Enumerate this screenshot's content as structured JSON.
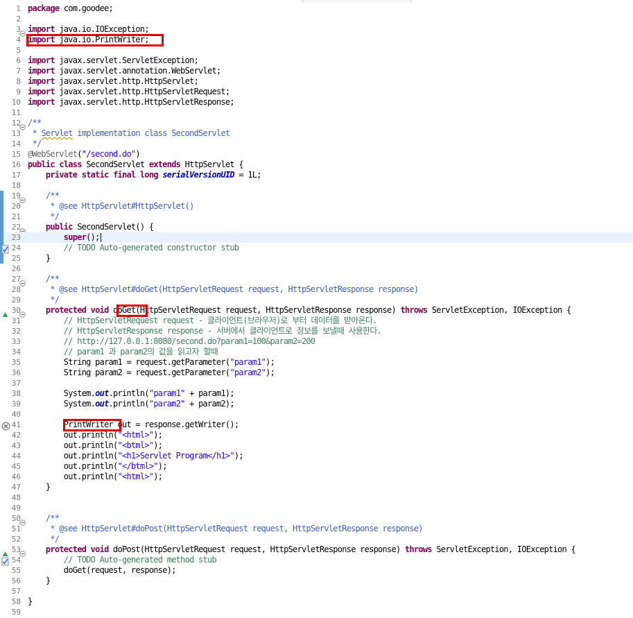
{
  "editor": {
    "language": "java",
    "current_line": 23,
    "lines": [
      {
        "n": "1",
        "t": [
          [
            "kw",
            "package"
          ],
          [
            "",
            "com.goodee;"
          ]
        ]
      },
      {
        "n": "2",
        "t": []
      },
      {
        "n": "3",
        "t": [
          [
            "kw",
            "import"
          ],
          [
            "",
            "java.io.IOException;"
          ]
        ],
        "fold": true
      },
      {
        "n": "4",
        "t": [
          [
            "kw",
            "import"
          ],
          [
            "",
            "java.io.PrintWriter;"
          ]
        ]
      },
      {
        "n": "5",
        "t": []
      },
      {
        "n": "6",
        "t": [
          [
            "kw",
            "import"
          ],
          [
            "",
            "javax.servlet.ServletException;"
          ]
        ]
      },
      {
        "n": "7",
        "t": [
          [
            "kw",
            "import"
          ],
          [
            "",
            "javax.servlet.annotation.WebServlet;"
          ]
        ]
      },
      {
        "n": "8",
        "t": [
          [
            "kw",
            "import"
          ],
          [
            "",
            "javax.servlet.http.HttpServlet;"
          ]
        ]
      },
      {
        "n": "9",
        "t": [
          [
            "kw",
            "import"
          ],
          [
            "",
            "javax.servlet.http.HttpServletRequest;"
          ]
        ]
      },
      {
        "n": "10",
        "t": [
          [
            "kw",
            "import"
          ],
          [
            "",
            "javax.servlet.http.HttpServletResponse;"
          ]
        ]
      },
      {
        "n": "11",
        "t": []
      },
      {
        "n": "12",
        "t": [
          [
            "jd",
            "/**"
          ]
        ],
        "fold": true
      },
      {
        "n": "13",
        "t": [
          [
            "jd",
            " * "
          ],
          [
            "jd sq",
            "Servlet"
          ],
          [
            "jd",
            " implementation class SecondServlet"
          ]
        ]
      },
      {
        "n": "14",
        "t": [
          [
            "jd",
            " */"
          ]
        ]
      },
      {
        "n": "15",
        "t": [
          [
            "ann",
            "@WebServlet"
          ],
          [
            "",
            "("
          ],
          [
            "str",
            "\"/second.do\""
          ],
          [
            "",
            ")"
          ]
        ]
      },
      {
        "n": "16",
        "t": [
          [
            "kw",
            "public"
          ],
          [
            "",
            " "
          ],
          [
            "kw",
            "class"
          ],
          [
            "",
            " SecondServlet "
          ],
          [
            "kw",
            "extends"
          ],
          [
            "",
            " HttpServlet {"
          ]
        ]
      },
      {
        "n": "17",
        "t": [
          [
            "",
            "    "
          ],
          [
            "kw",
            "private"
          ],
          [
            "",
            " "
          ],
          [
            "kw",
            "static"
          ],
          [
            "",
            " "
          ],
          [
            "kw",
            "final"
          ],
          [
            "",
            " "
          ],
          [
            "kw",
            "long"
          ],
          [
            "",
            " "
          ],
          [
            "sfld",
            "serialVersionUID"
          ],
          [
            "",
            " = 1L;"
          ]
        ]
      },
      {
        "n": "18",
        "t": []
      },
      {
        "n": "19",
        "t": [
          [
            "",
            "    "
          ],
          [
            "jd",
            "/**"
          ]
        ],
        "fold": true,
        "bar": true
      },
      {
        "n": "20",
        "t": [
          [
            "jd",
            "     * @see HttpServlet#HttpServlet()"
          ]
        ],
        "bar": true
      },
      {
        "n": "21",
        "t": [
          [
            "jd",
            "     */"
          ]
        ],
        "bar": true
      },
      {
        "n": "22",
        "t": [
          [
            "",
            "    "
          ],
          [
            "kw",
            "public"
          ],
          [
            "",
            " SecondServlet() {"
          ]
        ],
        "fold": true,
        "bar": true
      },
      {
        "n": "23",
        "t": [
          [
            "",
            "        "
          ],
          [
            "kw",
            "super"
          ],
          [
            "",
            "();"
          ]
        ],
        "bar": true,
        "cursor": true
      },
      {
        "n": "24",
        "t": [
          [
            "",
            "        "
          ],
          [
            "cm",
            "// TODO Auto-generated constructor stub"
          ]
        ],
        "bar": true,
        "task": true
      },
      {
        "n": "25",
        "t": [
          [
            "",
            "    }"
          ]
        ],
        "bar": true
      },
      {
        "n": "26",
        "t": []
      },
      {
        "n": "27",
        "t": [
          [
            "",
            "    "
          ],
          [
            "jd",
            "/**"
          ]
        ],
        "fold": true
      },
      {
        "n": "28",
        "t": [
          [
            "jd",
            "     * @see HttpServlet#doGet(HttpServletRequest request, HttpServletResponse response)"
          ]
        ]
      },
      {
        "n": "29",
        "t": [
          [
            "jd",
            "     */"
          ]
        ]
      },
      {
        "n": "30",
        "t": [
          [
            "",
            "    "
          ],
          [
            "kw",
            "protected"
          ],
          [
            "",
            " "
          ],
          [
            "kw",
            "void"
          ],
          [
            "",
            " doGet(HttpServletRequest request, HttpServletResponse response) "
          ],
          [
            "kw",
            "throws"
          ],
          [
            "",
            " ServletException, IOException {"
          ]
        ],
        "fold": true,
        "override": true
      },
      {
        "n": "31",
        "t": [
          [
            "",
            "        "
          ],
          [
            "cm",
            "// HttpServletRequest request - 클라이언트(브라우저)로 부터 데이터를 받아온다."
          ]
        ]
      },
      {
        "n": "32",
        "t": [
          [
            "",
            "        "
          ],
          [
            "cm",
            "// HttpServletResponse response - 서버에서 클라이언트로 정보를 보낼때 사용한다."
          ]
        ]
      },
      {
        "n": "33",
        "t": [
          [
            "",
            "        "
          ],
          [
            "cm",
            "// http://127.0.0.1:8080/second.do?param1=100&param2=200"
          ]
        ]
      },
      {
        "n": "34",
        "t": [
          [
            "",
            "        "
          ],
          [
            "cm",
            "// param1 과 param2의 값을 읽고자 할때"
          ]
        ]
      },
      {
        "n": "35",
        "t": [
          [
            "",
            "        String param1 = request.getParameter("
          ],
          [
            "str",
            "\"param1\""
          ],
          [
            "",
            ");"
          ]
        ]
      },
      {
        "n": "36",
        "t": [
          [
            "",
            "        String param2 = request.getParameter("
          ],
          [
            "str",
            "\"param2\""
          ],
          [
            "",
            ");"
          ]
        ]
      },
      {
        "n": "37",
        "t": []
      },
      {
        "n": "38",
        "t": [
          [
            "",
            "        System."
          ],
          [
            "sfld",
            "out"
          ],
          [
            "",
            ".println("
          ],
          [
            "str",
            "\"param1\""
          ],
          [
            "",
            " + param1);"
          ]
        ]
      },
      {
        "n": "39",
        "t": [
          [
            "",
            "        System."
          ],
          [
            "sfld",
            "out"
          ],
          [
            "",
            ".println("
          ],
          [
            "str",
            "\"param2\""
          ],
          [
            "",
            " + param2);"
          ]
        ]
      },
      {
        "n": "40",
        "t": []
      },
      {
        "n": "41",
        "t": [
          [
            "",
            "        PrintWriter out = response.getWriter();"
          ]
        ],
        "error": true
      },
      {
        "n": "42",
        "t": [
          [
            "",
            "        out.println("
          ],
          [
            "str",
            "\"<html>\""
          ],
          [
            "",
            ");"
          ]
        ]
      },
      {
        "n": "43",
        "t": [
          [
            "",
            "        out.println("
          ],
          [
            "str",
            "\"<btml>\""
          ],
          [
            "",
            ");"
          ]
        ]
      },
      {
        "n": "44",
        "t": [
          [
            "",
            "        out.println("
          ],
          [
            "str",
            "\"<h1>Servlet Program</h1>\""
          ],
          [
            "",
            ");"
          ]
        ]
      },
      {
        "n": "45",
        "t": [
          [
            "",
            "        out.println("
          ],
          [
            "str",
            "\"</btml>\""
          ],
          [
            "",
            ");"
          ]
        ]
      },
      {
        "n": "46",
        "t": [
          [
            "",
            "        out.println("
          ],
          [
            "str",
            "\"<html>\""
          ],
          [
            "",
            ");"
          ]
        ]
      },
      {
        "n": "47",
        "t": [
          [
            "",
            "    }"
          ]
        ]
      },
      {
        "n": "48",
        "t": []
      },
      {
        "n": "49",
        "t": []
      },
      {
        "n": "50",
        "t": [
          [
            "",
            "    "
          ],
          [
            "jd",
            "/**"
          ]
        ],
        "fold": true
      },
      {
        "n": "51",
        "t": [
          [
            "jd",
            "     * @see HttpServlet#doPost(HttpServletRequest request, HttpServletResponse response)"
          ]
        ]
      },
      {
        "n": "52",
        "t": [
          [
            "jd",
            "     */"
          ]
        ]
      },
      {
        "n": "53",
        "t": [
          [
            "",
            "    "
          ],
          [
            "kw",
            "protected"
          ],
          [
            "",
            " "
          ],
          [
            "kw",
            "void"
          ],
          [
            "",
            " doPost(HttpServletRequest request, HttpServletResponse response) "
          ],
          [
            "kw",
            "throws"
          ],
          [
            "",
            " ServletException, IOException {"
          ]
        ],
        "fold": true,
        "override": true
      },
      {
        "n": "54",
        "t": [
          [
            "",
            "        "
          ],
          [
            "cm",
            "// TODO Auto-generated method stub"
          ]
        ],
        "task": true
      },
      {
        "n": "55",
        "t": [
          [
            "",
            "        doGet(request, response);"
          ]
        ]
      },
      {
        "n": "56",
        "t": [
          [
            "",
            "    }"
          ]
        ]
      },
      {
        "n": "57",
        "t": []
      },
      {
        "n": "58",
        "t": [
          [
            "",
            "}"
          ]
        ]
      },
      {
        "n": "59",
        "t": []
      }
    ]
  },
  "highlights": [
    {
      "name": "highlight-import-printwriter",
      "line": 4
    },
    {
      "name": "highlight-doget",
      "line": 30
    },
    {
      "name": "highlight-printwriter-type",
      "line": 41
    }
  ],
  "colors": {
    "keyword": "#7f0055",
    "comment": "#3f7f5f",
    "javadoc": "#3f5fbf",
    "string": "#2a00ff",
    "field": "#0000c0",
    "highlight_box": "#e60000",
    "current_line": "#e8f2fe"
  },
  "icons": {
    "fold": "fold-minus-icon",
    "override": "override-triangle-icon",
    "task": "task-marker-icon",
    "error": "error-circle-icon"
  }
}
